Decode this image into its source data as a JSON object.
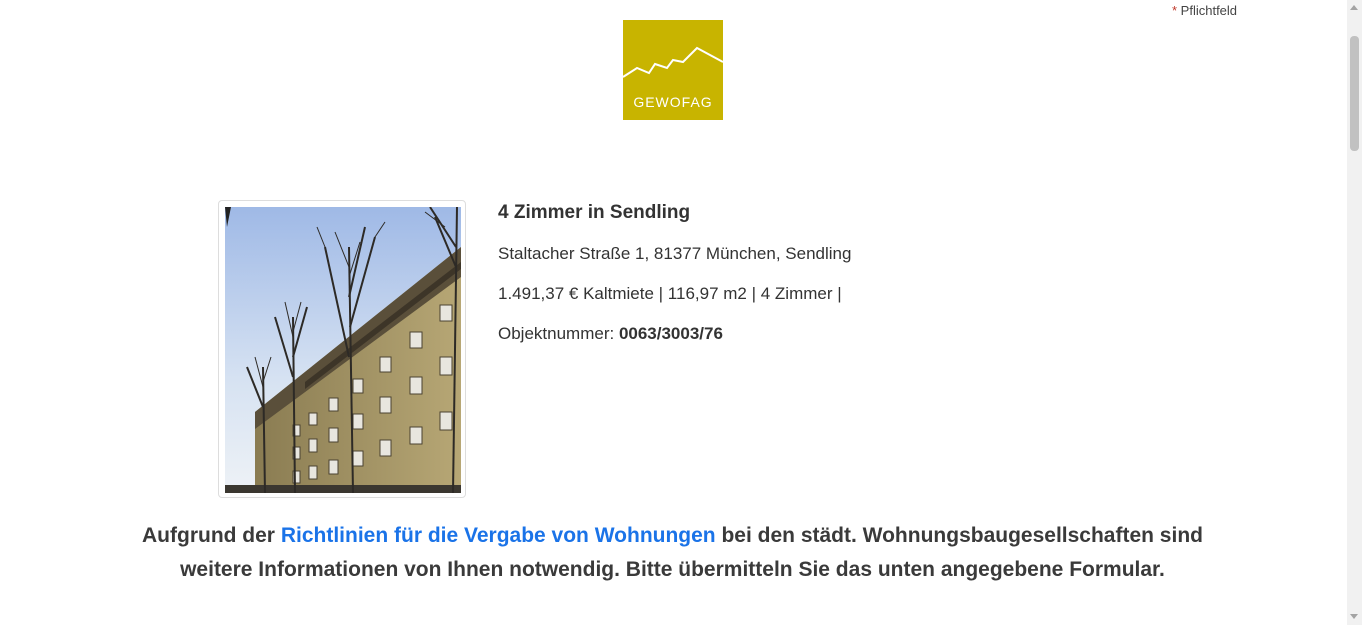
{
  "header": {
    "required_star": "*",
    "required_label": " Pflichtfeld",
    "logo_text": "GEWOFAG",
    "logo_color": "#c8b400"
  },
  "listing": {
    "title": "4 Zimmer in Sendling",
    "address": "Staltacher Straße 1, 81377 München, Sendling",
    "details": "1.491,37 € Kaltmiete | 116,97 m2 | 4 Zimmer |",
    "object_number_label": "Objektnummer: ",
    "object_number": "0063/3003/76"
  },
  "notice": {
    "prefix": "Aufgrund der ",
    "link_text": "Richtlinien für die Vergabe von Wohnungen",
    "suffix": " bei den städt. Wohnungsbaugesellschaften sind weitere Informationen von Ihnen notwendig. Bitte übermitteln Sie das unten angegebene Formular.",
    "link_color": "#1a73e8"
  }
}
